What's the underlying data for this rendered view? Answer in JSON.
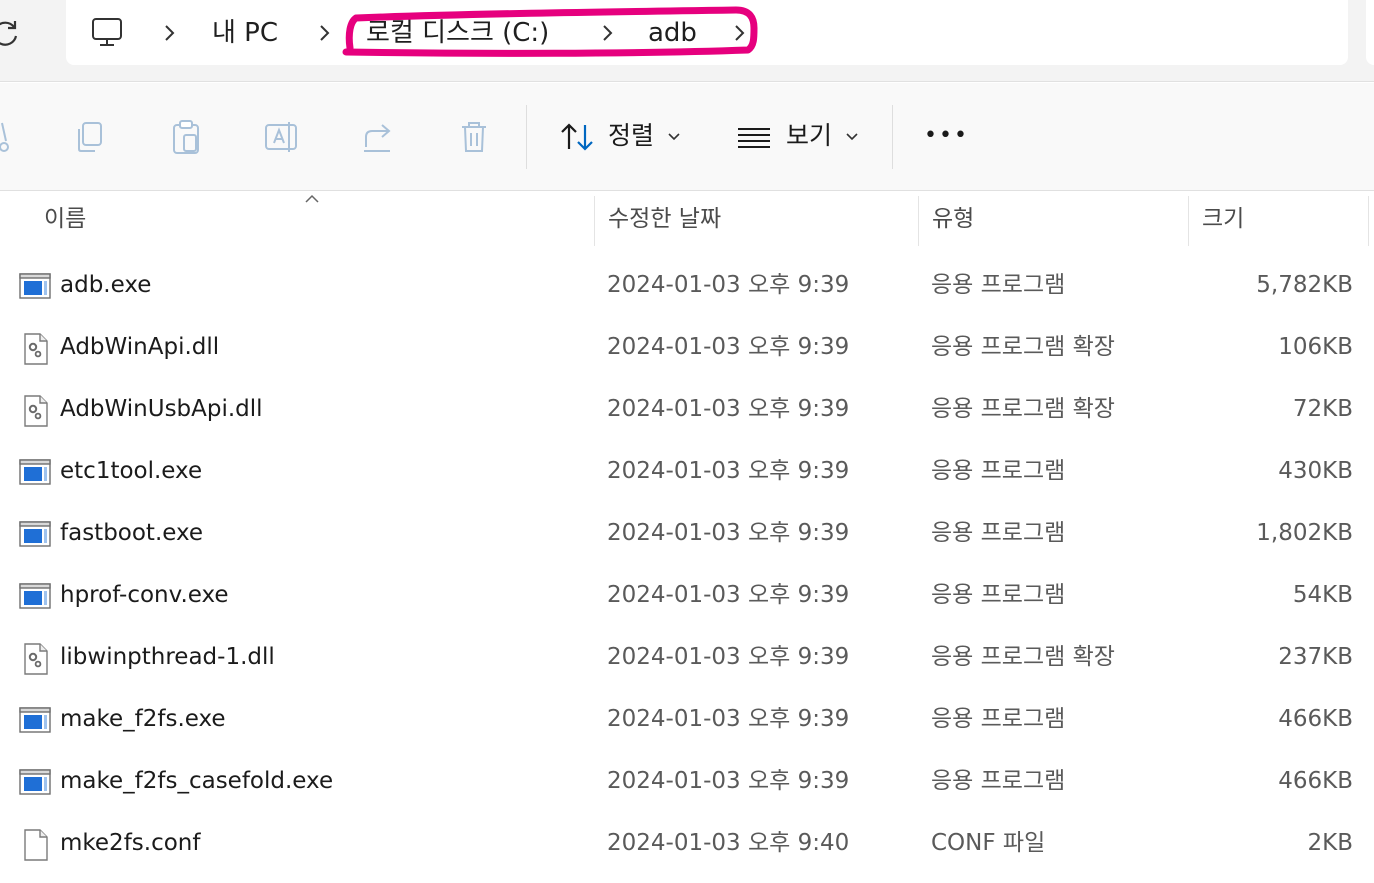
{
  "breadcrumb": {
    "items": [
      "내 PC",
      "로컬 디스크 (C:)",
      "adb"
    ]
  },
  "toolbar": {
    "sort_label": "정렬",
    "view_label": "보기",
    "more_label": "•••"
  },
  "columns": {
    "name": "이름",
    "modified": "수정한 날짜",
    "type": "유형",
    "size": "크기"
  },
  "files": [
    {
      "name": "adb.exe",
      "modified": "2024-01-03 오후 9:39",
      "type": "응용 프로그램",
      "size": "5,782KB",
      "icon": "exe-icon"
    },
    {
      "name": "AdbWinApi.dll",
      "modified": "2024-01-03 오후 9:39",
      "type": "응용 프로그램 확장",
      "size": "106KB",
      "icon": "dll-icon"
    },
    {
      "name": "AdbWinUsbApi.dll",
      "modified": "2024-01-03 오후 9:39",
      "type": "응용 프로그램 확장",
      "size": "72KB",
      "icon": "dll-icon"
    },
    {
      "name": "etc1tool.exe",
      "modified": "2024-01-03 오후 9:39",
      "type": "응용 프로그램",
      "size": "430KB",
      "icon": "exe-icon"
    },
    {
      "name": "fastboot.exe",
      "modified": "2024-01-03 오후 9:39",
      "type": "응용 프로그램",
      "size": "1,802KB",
      "icon": "exe-icon"
    },
    {
      "name": "hprof-conv.exe",
      "modified": "2024-01-03 오후 9:39",
      "type": "응용 프로그램",
      "size": "54KB",
      "icon": "exe-icon"
    },
    {
      "name": "libwinpthread-1.dll",
      "modified": "2024-01-03 오후 9:39",
      "type": "응용 프로그램 확장",
      "size": "237KB",
      "icon": "dll-icon"
    },
    {
      "name": "make_f2fs.exe",
      "modified": "2024-01-03 오후 9:39",
      "type": "응용 프로그램",
      "size": "466KB",
      "icon": "exe-icon"
    },
    {
      "name": "make_f2fs_casefold.exe",
      "modified": "2024-01-03 오후 9:39",
      "type": "응용 프로그램",
      "size": "466KB",
      "icon": "exe-icon"
    },
    {
      "name": "mke2fs.conf",
      "modified": "2024-01-03 오후 9:40",
      "type": "CONF 파일",
      "size": "2KB",
      "icon": "file-icon"
    }
  ],
  "colors": {
    "annotation": "#e6007e",
    "accent": "#0067c0"
  }
}
